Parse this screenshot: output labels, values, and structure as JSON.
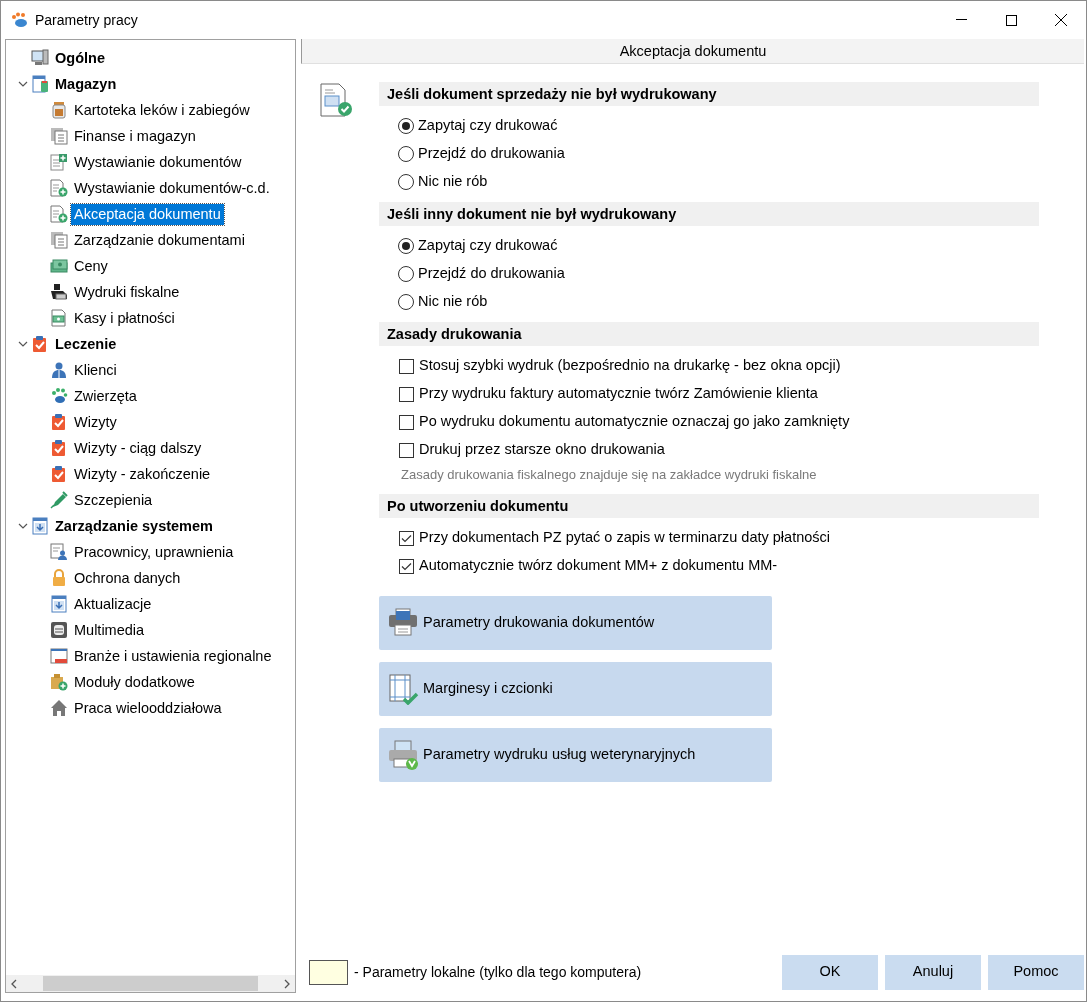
{
  "window": {
    "title": "Parametry pracy"
  },
  "tree": [
    {
      "label": "Ogólne",
      "selected": false
    },
    {
      "label": "Magazyn",
      "selected": false,
      "expanded": true,
      "children": [
        {
          "label": "Kartoteka leków i zabiegów",
          "selected": false
        },
        {
          "label": "Finanse i magazyn",
          "selected": false
        },
        {
          "label": "Wystawianie dokumentów",
          "selected": false
        },
        {
          "label": "Wystawianie dokumentów-c.d.",
          "selected": false
        },
        {
          "label": "Akceptacja dokumentu",
          "selected": true
        },
        {
          "label": "Zarządzanie dokumentami",
          "selected": false
        },
        {
          "label": "Ceny",
          "selected": false
        },
        {
          "label": "Wydruki fiskalne",
          "selected": false
        },
        {
          "label": "Kasy i płatności",
          "selected": false
        }
      ]
    },
    {
      "label": "Leczenie",
      "selected": false,
      "expanded": true,
      "children": [
        {
          "label": "Klienci",
          "selected": false
        },
        {
          "label": "Zwierzęta",
          "selected": false
        },
        {
          "label": "Wizyty",
          "selected": false
        },
        {
          "label": "Wizyty - ciąg dalszy",
          "selected": false
        },
        {
          "label": "Wizyty - zakończenie",
          "selected": false
        },
        {
          "label": "Szczepienia",
          "selected": false
        }
      ]
    },
    {
      "label": "Zarządzanie systemem",
      "selected": false,
      "expanded": true,
      "children": [
        {
          "label": "Pracownicy, uprawnienia",
          "selected": false
        },
        {
          "label": "Ochrona danych",
          "selected": false
        },
        {
          "label": "Aktualizacje",
          "selected": false
        },
        {
          "label": "Multimedia",
          "selected": false
        },
        {
          "label": "Branże i ustawienia regionalne",
          "selected": false
        },
        {
          "label": "Moduły dodatkowe",
          "selected": false
        },
        {
          "label": "Praca wielooddziałowa",
          "selected": false
        }
      ]
    }
  ],
  "page": {
    "title": "Akceptacja dokumentu"
  },
  "sections": [
    {
      "title": "Jeśli dokument sprzedaży nie był wydrukowany",
      "kind": "radio",
      "options": [
        {
          "label": "Zapytaj czy drukować",
          "selected": true
        },
        {
          "label": "Przejdź do drukowania",
          "selected": false
        },
        {
          "label": "Nic nie rób",
          "selected": false
        }
      ]
    },
    {
      "title": "Jeśli inny dokument nie był wydrukowany",
      "kind": "radio",
      "options": [
        {
          "label": "Zapytaj czy drukować",
          "selected": true
        },
        {
          "label": "Przejdź do drukowania",
          "selected": false
        },
        {
          "label": "Nic nie rób",
          "selected": false
        }
      ]
    },
    {
      "title": "Zasady drukowania",
      "kind": "checkbox",
      "options": [
        {
          "label": "Stosuj szybki wydruk (bezpośrednio na drukarkę - bez okna opcji)",
          "checked": false
        },
        {
          "label": "Przy wydruku faktury automatycznie twórz Zamówienie klienta",
          "checked": false
        },
        {
          "label": "Po wydruku dokumentu automatycznie oznaczaj go jako zamknięty",
          "checked": false
        },
        {
          "label": "Drukuj przez starsze okno drukowania",
          "checked": false
        }
      ],
      "note": "Zasady drukowania fiskalnego znajduje się na zakładce wydruki fiskalne"
    },
    {
      "title": "Po utworzeniu dokumentu",
      "kind": "checkbox",
      "options": [
        {
          "label": "Przy dokumentach PZ pytać o zapis w terminarzu daty płatności",
          "checked": true
        },
        {
          "label": "Automatycznie twórz dokument MM+ z dokumentu MM-",
          "checked": true
        }
      ]
    }
  ],
  "actions": [
    {
      "label": "Parametry drukowania dokumentów"
    },
    {
      "label": "Marginesy i czcionki"
    },
    {
      "label": "Parametry wydruku usług weterynaryjnych"
    }
  ],
  "legend": {
    "text": "- Parametry lokalne (tylko dla tego komputera)"
  },
  "buttons": [
    {
      "label": "OK"
    },
    {
      "label": "Anuluj"
    },
    {
      "label": "Pomoc"
    }
  ]
}
